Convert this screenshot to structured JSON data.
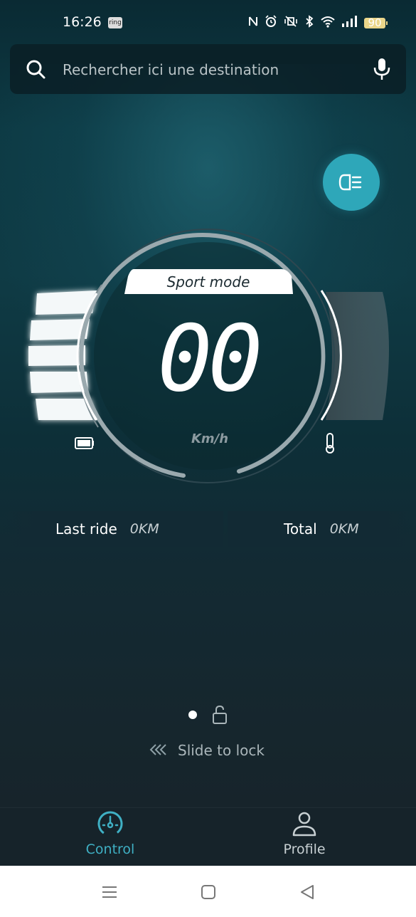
{
  "status_bar": {
    "time": "16:26",
    "ring_badge": "ring",
    "icons": [
      "nfc-icon",
      "alarm-icon",
      "vibrate-icon",
      "bluetooth-icon",
      "wifi-icon",
      "signal-icon"
    ],
    "battery": "90"
  },
  "search": {
    "placeholder": "Rechercher ici une destination",
    "value": ""
  },
  "dashboard": {
    "mode": "Sport mode",
    "speed": "00",
    "unit": "Km/h",
    "battery_level_bars": 5,
    "temperature_level": 0
  },
  "stats": {
    "last_ride_label": "Last ride",
    "last_ride_value": "0KM",
    "total_label": "Total",
    "total_value": "0KM"
  },
  "lock": {
    "slide_label": "Slide to lock"
  },
  "tabs": [
    {
      "label": "Control",
      "icon": "speedometer-icon",
      "active": true
    },
    {
      "label": "Profile",
      "icon": "person-icon",
      "active": false
    }
  ],
  "colors": {
    "accent": "#3fb0c4",
    "headlight_button": "#2ea7b9",
    "background_top": "#0a2a33",
    "background_bottom": "#1a2329"
  }
}
